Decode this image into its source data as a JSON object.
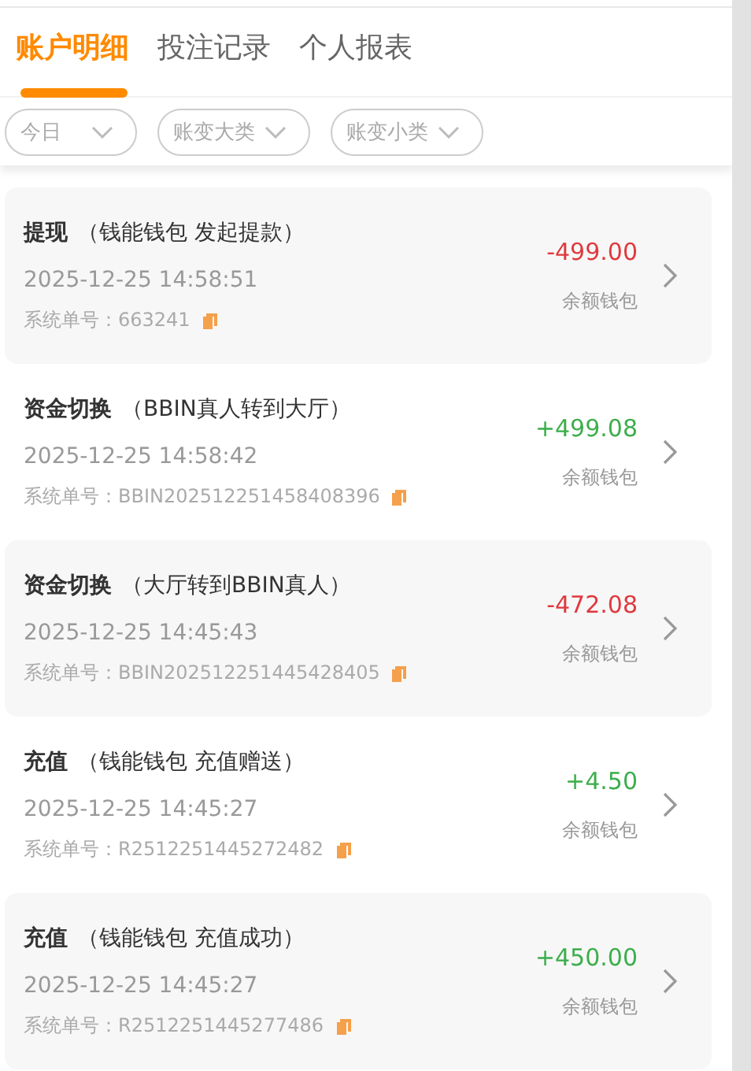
{
  "tabs": [
    {
      "label": "账户明细",
      "selected": true
    },
    {
      "label": "投注记录",
      "selected": false
    },
    {
      "label": "个人报表",
      "selected": false
    }
  ],
  "filters": [
    {
      "label": "今日"
    },
    {
      "label": "账变大类"
    },
    {
      "label": "账变小类"
    }
  ],
  "records": [
    {
      "type": "提现",
      "detail": "（钱能钱包 发起提款）",
      "time": "2025-12-25 14:58:51",
      "order_label": "系统单号：",
      "order_no": "663241",
      "amount": "-499.00",
      "color": "#e0393e",
      "wallet": "余额钱包"
    },
    {
      "type": "资金切换",
      "detail": "（BBIN真人转到大厅）",
      "time": "2025-12-25 14:58:42",
      "order_label": "系统单号：",
      "order_no": "BBIN202512251458408396",
      "amount": "+499.08",
      "color": "#3cae4b",
      "wallet": "余额钱包"
    },
    {
      "type": "资金切换",
      "detail": "（大厅转到BBIN真人）",
      "time": "2025-12-25 14:45:43",
      "order_label": "系统单号：",
      "order_no": "BBIN202512251445428405",
      "amount": "-472.08",
      "color": "#e0393e",
      "wallet": "余额钱包"
    },
    {
      "type": "充值",
      "detail": "（钱能钱包 充值赠送）",
      "time": "2025-12-25 14:45:27",
      "order_label": "系统单号：",
      "order_no": "R2512251445272482",
      "amount": "+4.50",
      "color": "#3cae4b",
      "wallet": "余额钱包"
    },
    {
      "type": "充值",
      "detail": "（钱能钱包 充值成功）",
      "time": "2025-12-25 14:45:27",
      "order_label": "系统单号：",
      "order_no": "R2512251445277486",
      "amount": "+450.00",
      "color": "#3cae4b",
      "wallet": "余额钱包"
    }
  ]
}
